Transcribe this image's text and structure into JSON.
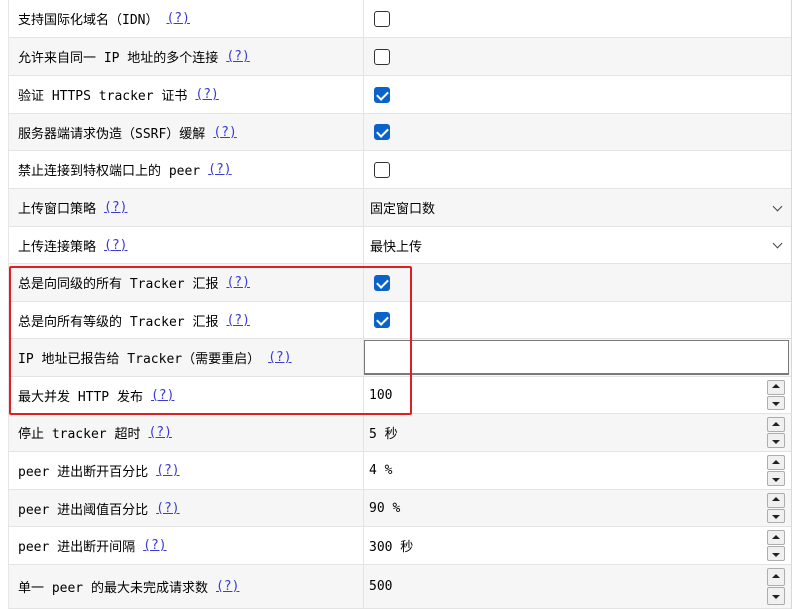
{
  "help_link": "(?)",
  "rows": [
    {
      "label": "支持国际化域名（IDN）",
      "control": "checkbox",
      "checked": false
    },
    {
      "label": "允许来自同一 IP 地址的多个连接",
      "control": "checkbox",
      "checked": false
    },
    {
      "label": "验证 HTTPS tracker 证书",
      "control": "checkbox",
      "checked": true
    },
    {
      "label": "服务器端请求伪造（SSRF）缓解",
      "control": "checkbox",
      "checked": true
    },
    {
      "label": "禁止连接到特权端口上的 peer",
      "control": "checkbox",
      "checked": false
    },
    {
      "label": "上传窗口策略",
      "control": "select",
      "value": "固定窗口数"
    },
    {
      "label": "上传连接策略",
      "control": "select",
      "value": "最快上传"
    },
    {
      "label": "总是向同级的所有 Tracker 汇报",
      "control": "checkbox",
      "checked": true
    },
    {
      "label": "总是向所有等级的 Tracker 汇报",
      "control": "checkbox",
      "checked": true
    },
    {
      "label": "IP 地址已报告给 Tracker（需要重启）",
      "control": "text",
      "value": ""
    },
    {
      "label": "最大并发 HTTP 发布",
      "control": "spin",
      "value": "100"
    },
    {
      "label": "停止 tracker 超时",
      "control": "spin",
      "value": "5 秒"
    },
    {
      "label": "peer 进出断开百分比",
      "control": "spin",
      "value": "4 %"
    },
    {
      "label": "peer 进出阈值百分比",
      "control": "spin",
      "value": "90 %"
    },
    {
      "label": "peer 进出断开间隔",
      "control": "spin",
      "value": "300 秒"
    },
    {
      "label": "单一 peer 的最大未完成请求数",
      "control": "spin",
      "value": "500"
    }
  ],
  "colors": {
    "accent": "#0a63c9",
    "highlight": "#e02020",
    "link": "#3a3ad6"
  }
}
